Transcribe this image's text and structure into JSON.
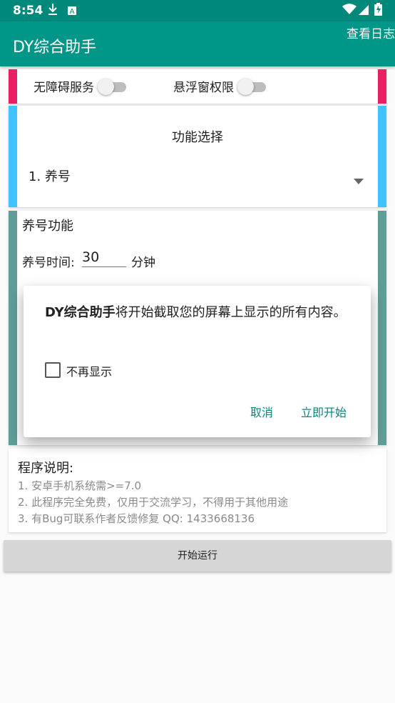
{
  "status": {
    "time": "8:54",
    "icons": [
      "download-icon",
      "notification-a-icon",
      "wifi-icon",
      "signal-icon",
      "battery-icon"
    ]
  },
  "appbar": {
    "title": "DY综合助手",
    "log_link": "查看日志"
  },
  "permissions": {
    "accessibility_label": "无障碍服务",
    "accessibility_on": false,
    "overlay_label": "悬浮窗权限",
    "overlay_on": false
  },
  "function_select": {
    "title": "功能选择",
    "selected": "1. 养号"
  },
  "feature": {
    "title": "养号功能",
    "time_label": "养号时间:",
    "time_value": "30",
    "time_unit": "分钟"
  },
  "dialog": {
    "app_name": "DY综合助手",
    "message": "将开始截取您的屏幕上显示的所有内容。",
    "checkbox_label": "不再显示",
    "checkbox_checked": false,
    "cancel": "取消",
    "confirm": "立即开始"
  },
  "info": {
    "title": "程序说明:",
    "lines": [
      "1. 安卓手机系统需>=7.0",
      "2. 此程序完全免费，仅用于交流学习，不得用于其他用途",
      "3. 有Bug可联系作者反馈修复 QQ: 1433668136"
    ]
  },
  "start_button": "开始运行",
  "colors": {
    "primary_dark": "#00897b",
    "primary": "#009688",
    "accent_pink": "#e91e63",
    "accent_blue": "#40c4ff",
    "accent_teal": "#5f9e98"
  }
}
